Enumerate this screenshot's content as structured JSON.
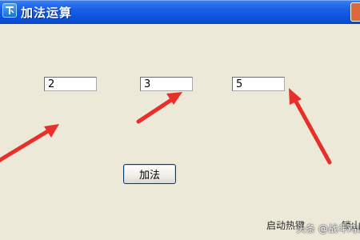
{
  "window": {
    "title": "加法运算"
  },
  "fields": {
    "a": "2",
    "b": "3",
    "c": "5"
  },
  "buttons": {
    "add_label": "加法"
  },
  "footer": {
    "left_text": "启动热键",
    "right_text": "锁山"
  },
  "watermark": {
    "text": "头条 @战斗鸡山"
  },
  "annotations": {
    "arrow_color": "#e8302a"
  },
  "icons": {
    "app": "app-icon"
  }
}
